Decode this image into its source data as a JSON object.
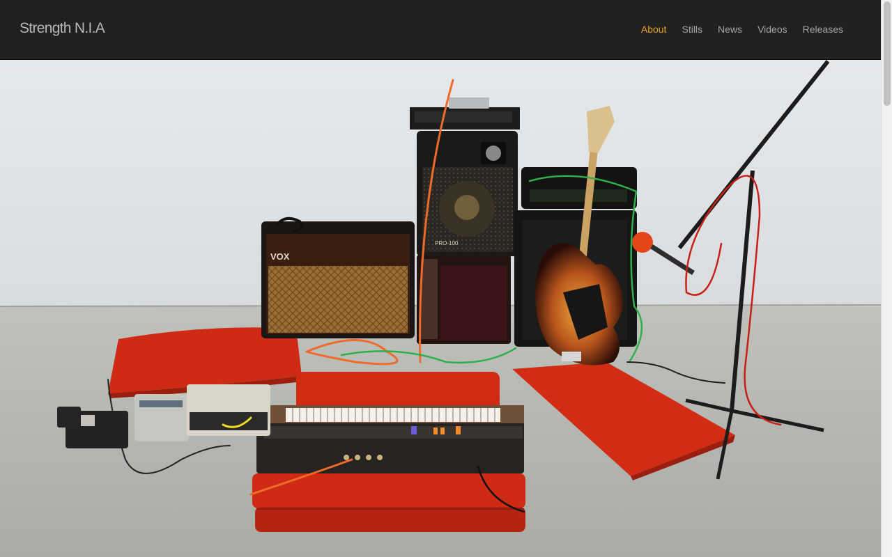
{
  "site": {
    "brand": "Strength N.I.A",
    "nav": [
      {
        "label": "About",
        "active": true
      },
      {
        "label": "Stills",
        "active": false
      },
      {
        "label": "News",
        "active": false
      },
      {
        "label": "Videos",
        "active": false
      },
      {
        "label": "Releases",
        "active": false
      }
    ],
    "accent_color": "#e6a11d"
  },
  "hero": {
    "amp_brand": "VOX",
    "speaker_model": "PRO-100"
  }
}
